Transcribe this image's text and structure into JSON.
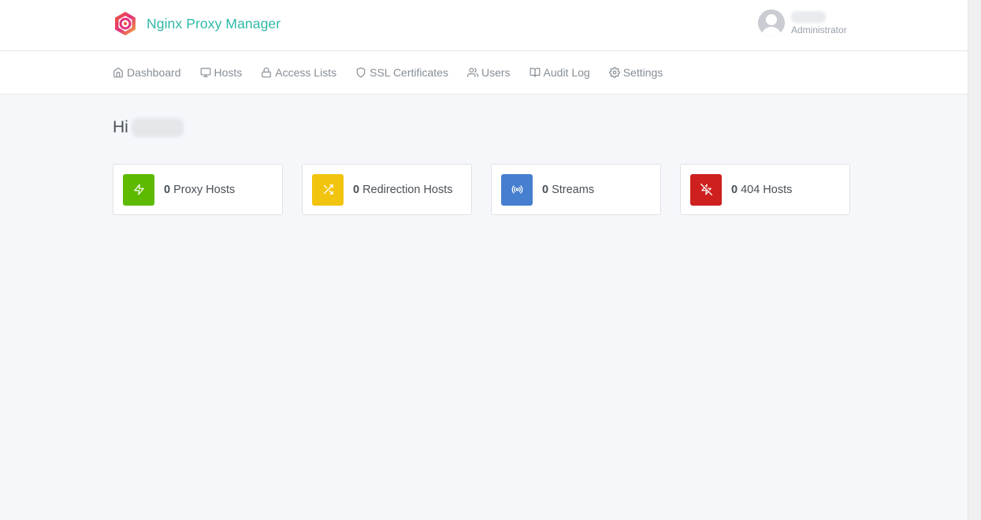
{
  "brand": {
    "name": "Nginx Proxy Manager",
    "logo_icon": "nginx-proxy-manager-logo"
  },
  "user": {
    "role": "Administrator",
    "avatar_icon": "user-avatar-icon"
  },
  "nav": {
    "items": [
      {
        "label": "Dashboard",
        "icon": "home-icon"
      },
      {
        "label": "Hosts",
        "icon": "monitor-icon"
      },
      {
        "label": "Access Lists",
        "icon": "lock-icon"
      },
      {
        "label": "SSL Certificates",
        "icon": "shield-icon"
      },
      {
        "label": "Users",
        "icon": "users-icon"
      },
      {
        "label": "Audit Log",
        "icon": "book-icon"
      },
      {
        "label": "Settings",
        "icon": "settings-icon"
      }
    ]
  },
  "greeting": {
    "prefix": "Hi"
  },
  "stats": [
    {
      "count": "0",
      "label": "Proxy Hosts",
      "icon": "zap-icon",
      "color": "#5eba00"
    },
    {
      "count": "0",
      "label": "Redirection Hosts",
      "icon": "shuffle-icon",
      "color": "#f1c40f"
    },
    {
      "count": "0",
      "label": "Streams",
      "icon": "radio-icon",
      "color": "#467fcf"
    },
    {
      "count": "0",
      "label": "404 Hosts",
      "icon": "zap-off-icon",
      "color": "#cd201f"
    }
  ]
}
